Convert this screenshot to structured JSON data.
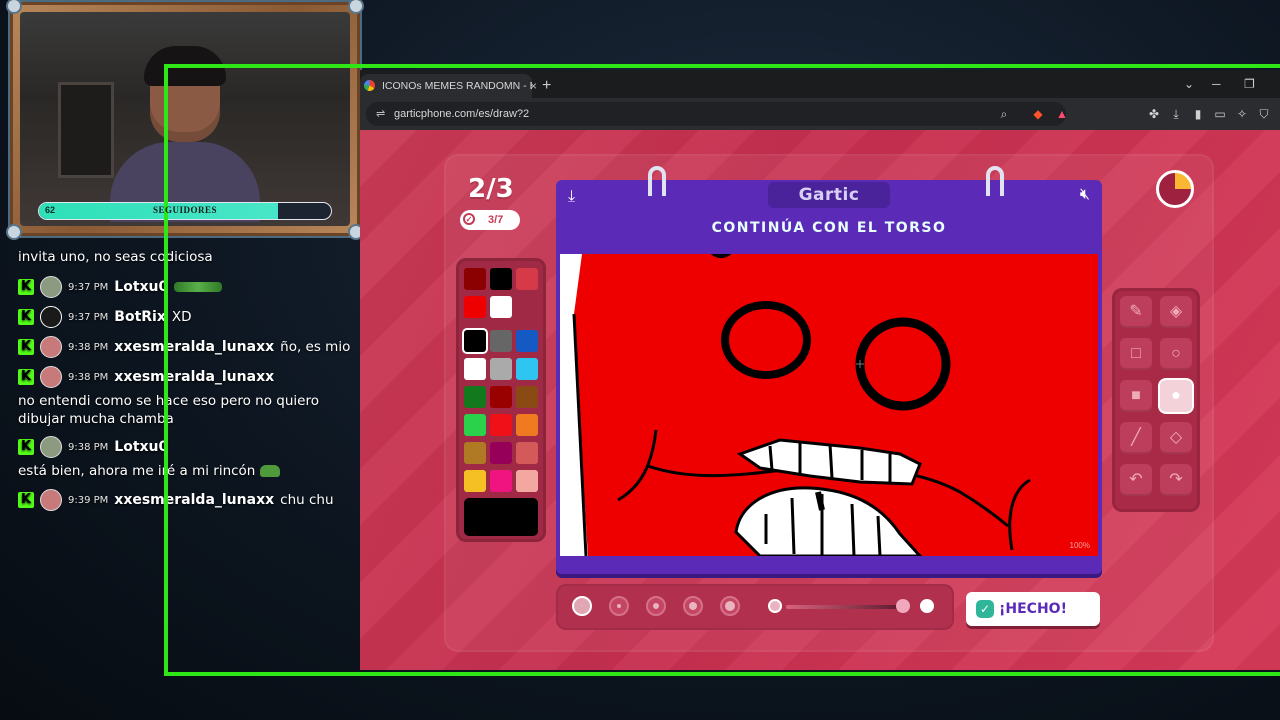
{
  "webcam": {
    "follower_count": "62",
    "follower_label": "SEGUIDORES",
    "follower_progress": 0.82
  },
  "chat": {
    "messages": [
      {
        "time": "",
        "user": "",
        "text": "invita uno, no seas codiciosa"
      },
      {
        "time": "9:37 PM",
        "user": "Lotxu0",
        "text": ""
      },
      {
        "time": "9:37 PM",
        "user": "BotRix",
        "text": "XD"
      },
      {
        "time": "9:38 PM",
        "user": "xxesmeralda_lunaxx",
        "text": "ño, es mio"
      },
      {
        "time": "9:38 PM",
        "user": "xxesmeralda_lunaxx",
        "text": ""
      },
      {
        "time": "",
        "user": "",
        "text": "no entendi como se hace eso pero no quiero dibujar mucha chamba"
      },
      {
        "time": "9:38 PM",
        "user": "Lotxu0",
        "text": ""
      },
      {
        "time": "",
        "user": "",
        "text": "está bien, ahora me iré a mi rincón"
      },
      {
        "time": "9:39 PM",
        "user": "xxesmeralda_lunaxx",
        "text": "chu chu"
      }
    ]
  },
  "browser": {
    "tab_title": "ICONOs MEMES RANDOMN - Buscar",
    "tab_close": "×",
    "new_tab": "+",
    "url": "garticphone.com/es/draw?2"
  },
  "game": {
    "round": "2/3",
    "done_count": "3/7",
    "logo": "Gartic",
    "prompt": "CONTINÚA CON EL TORSO",
    "zoom": "100%",
    "done_button": "¡HECHO!",
    "timer_elapsed_fraction": 0.25,
    "colors": {
      "accent_purple": "#5b2bb8",
      "background": "#c93a55",
      "canvas_red": "#ee0000"
    },
    "palette_recent": [
      "#8b0000",
      "#000000",
      "#d63a48",
      "#ee0000",
      "#ffffff"
    ],
    "palette_main": [
      "#000000",
      "#666666",
      "#1459c4",
      "#ffffff",
      "#aaaaaa",
      "#2ec6f0",
      "#127a1c",
      "#990000",
      "#8a4a14",
      "#2ad14a",
      "#f01018",
      "#f07a20",
      "#b07a24",
      "#960058",
      "#d45a5a",
      "#f4c024",
      "#f01480",
      "#f2a8a0"
    ],
    "selected_color": "#000000",
    "tools": [
      "pencil-icon",
      "fill-bucket-icon",
      "rectangle-outline-icon",
      "ellipse-outline-icon",
      "rectangle-filled-icon",
      "ellipse-filled-icon",
      "line-icon",
      "eraser-icon",
      "undo-icon",
      "redo-icon"
    ],
    "selected_tool": "ellipse-filled-icon"
  }
}
